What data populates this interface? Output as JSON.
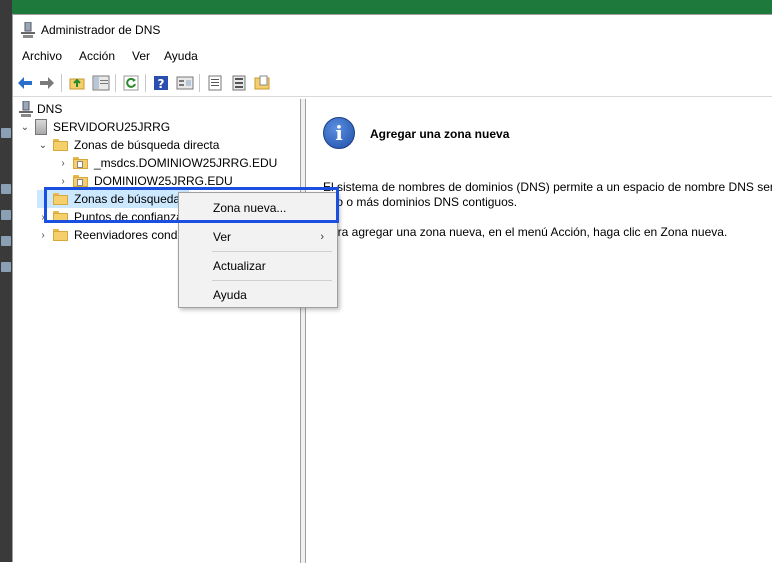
{
  "window": {
    "title": "Administrador de DNS"
  },
  "menubar": {
    "items": [
      "Archivo",
      "Acción",
      "Ver",
      "Ayuda"
    ]
  },
  "toolbar": {
    "buttons": [
      "back-icon",
      "forward-icon",
      "up-folder-icon",
      "show-hide-tree-icon",
      "refresh-icon",
      "help-icon",
      "properties-icon",
      "list-view-icon",
      "detail-view-icon",
      "zone-icon"
    ]
  },
  "tree": {
    "root": "DNS",
    "server": "SERVIDORU25JRRG",
    "forward_zones": "Zonas de búsqueda directa",
    "zone_msdcs": "_msdcs.DOMINIOW25JRRG.EDU",
    "zone_domain": "DOMINIOW25JRRG.EDU",
    "reverse_zones": "Zonas de búsqueda",
    "trust_points": "Puntos de confianza",
    "conditional_forwarders": "Reenviadores condi"
  },
  "context_menu": {
    "new_zone": "Zona nueva...",
    "view": "Ver",
    "refresh": "Actualizar",
    "help": "Ayuda"
  },
  "right_pane": {
    "heading": "Agregar una zona nueva",
    "paragraph_line1": "El sistema de nombres de dominios (DNS) permite a un espacio de nombre DNS ser d",
    "paragraph_line2": "uno o más dominios DNS contiguos.",
    "instruction": "Para agregar una zona nueva, en el menú Acción, haga clic en Zona nueva."
  },
  "colors": {
    "highlight": "#1a4fe0",
    "selection": "#cce8ff",
    "desktop_green": "#1e7a3c"
  }
}
